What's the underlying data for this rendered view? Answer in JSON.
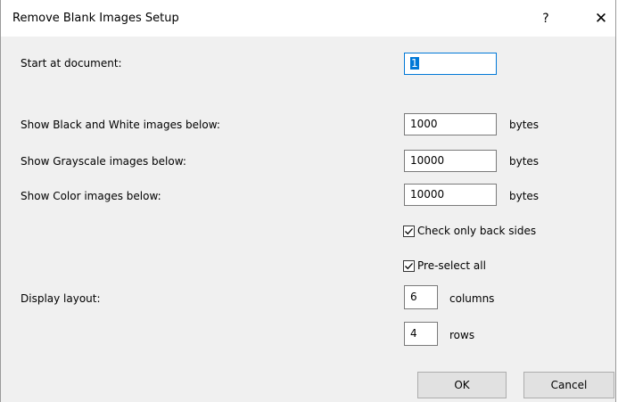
{
  "window": {
    "title": "Remove Blank Images Setup",
    "help_glyph": "?",
    "close_glyph": "✕"
  },
  "form": {
    "start_label": "Start at document:",
    "start_value": "1",
    "bw_label": "Show Black and White images below:",
    "bw_value": "1000",
    "gray_label": "Show Grayscale images below:",
    "gray_value": "10000",
    "color_label": "Show Color images below:",
    "color_value": "10000",
    "bytes_unit": "bytes",
    "back_sides_label": "Check only back sides",
    "back_sides_checked": true,
    "preselect_label": "Pre-select all",
    "preselect_checked": true,
    "layout_label": "Display layout:",
    "columns_value": "6",
    "columns_unit": "columns",
    "rows_value": "4",
    "rows_unit": "rows"
  },
  "buttons": {
    "ok": "OK",
    "cancel": "Cancel"
  },
  "colors": {
    "focus": "#0078d7",
    "dialog_bg": "#f0f0f0"
  }
}
